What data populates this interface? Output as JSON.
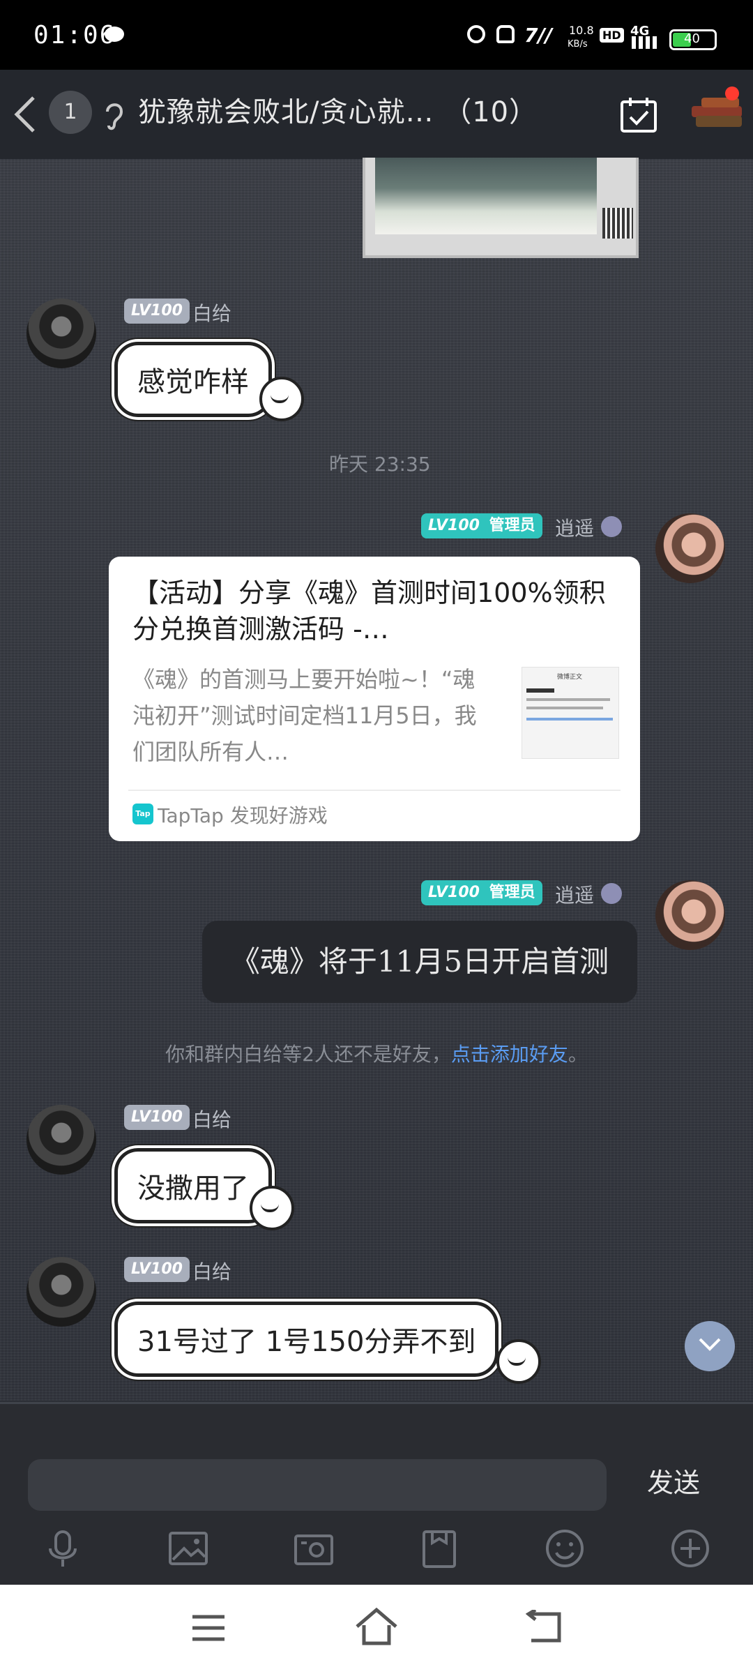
{
  "status_bar": {
    "time": "01:06",
    "net_speed_top": "10.8",
    "net_speed_bottom": "KB/s",
    "hd": "HD",
    "network": "4G",
    "battery": "40"
  },
  "header": {
    "unread_count": "1",
    "title": "犹豫就会败北/贪心就… （10）"
  },
  "messages": [
    {
      "level": "LV100",
      "nickname": "白给",
      "text": "感觉咋样"
    },
    {
      "timestamp": "昨天 23:35"
    },
    {
      "level": "LV100",
      "role": "管理员",
      "nickname": "逍遥"
    },
    {
      "level": "LV100",
      "role": "管理员",
      "nickname": "逍遥",
      "text": "《魂》将于11月5日开启首测"
    },
    {
      "level": "LV100",
      "nickname": "白给",
      "text": "没撒用了"
    },
    {
      "level": "LV100",
      "nickname": "白给",
      "text": "31号过了  1号150分弄不到"
    }
  ],
  "share_card": {
    "title": "【活动】分享《魂》首测时间100%领积分兑换首测激活码 -…",
    "description": "《魂》的首测马上要开始啦~！“魂沌初开”测试时间定档11月5日，我们团队所有人…",
    "thumb_title": "微博正文",
    "tap_icon_text": "Tap",
    "source": "TapTap 发现好游戏"
  },
  "notice": {
    "text": "你和群内白给等2人还不是好友，",
    "link": "点击添加好友",
    "end": "。"
  },
  "input": {
    "placeholder": "",
    "send_label": "发送"
  },
  "icons": [
    "back-icon",
    "ear-icon",
    "calendar-check-icon",
    "books-icon",
    "scroll-down-icon",
    "mic-icon",
    "image-icon",
    "camera-icon",
    "file-icon",
    "emoji-icon",
    "plus-icon",
    "menu-icon",
    "home-icon",
    "back-nav-icon"
  ],
  "colors": {
    "admin_badge": "#2fc4bd",
    "level_badge": "#a8aebb",
    "link": "#5a9cf2",
    "scroll_button": "#8fa2c2"
  }
}
